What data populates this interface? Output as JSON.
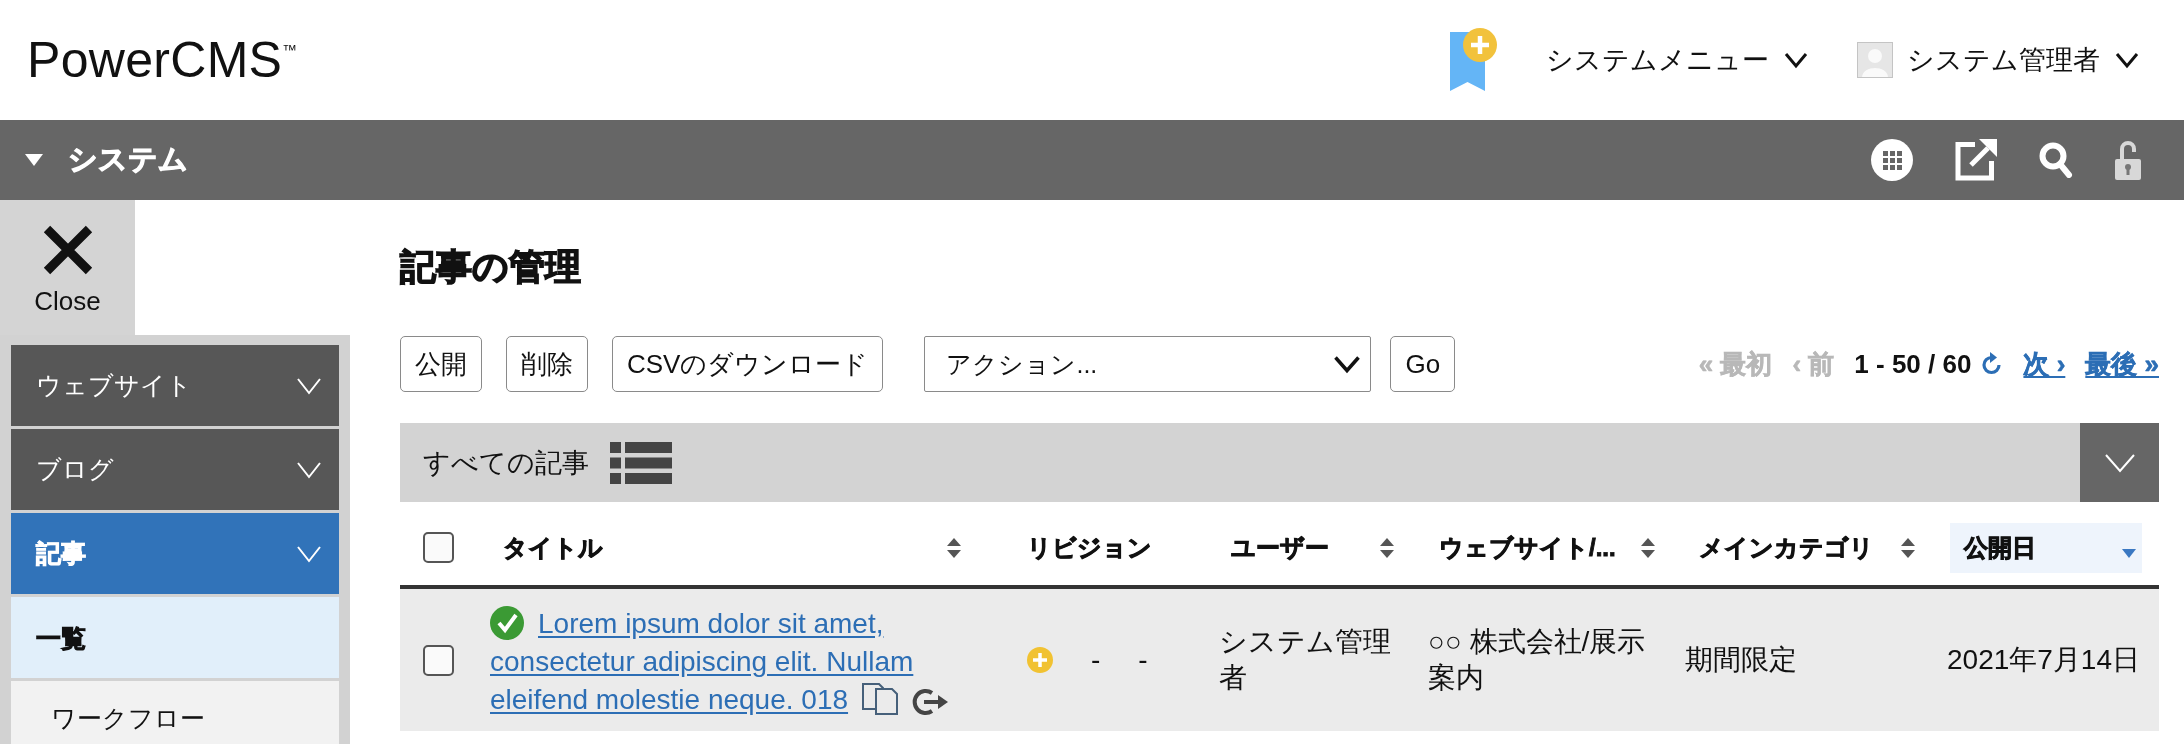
{
  "header": {
    "logo": "PowerCMS$^{™}$",
    "menus": [
      {
        "kind": "menu",
        "label": "システムメニュー"
      },
      {
        "kind": "user",
        "label": "システム管理者"
      }
    ]
  },
  "context_bar": {
    "title": "システム",
    "expanded": true
  },
  "sidebar": {
    "close_label": "Close",
    "items": [
      {
        "label": "ウェブサイト",
        "selected": false
      },
      {
        "label": "ブログ",
        "selected": false
      },
      {
        "label": "記事",
        "selected": true,
        "children": [
          {
            "label": "一覧",
            "selected": true
          },
          {
            "label": "ワークフロー",
            "selected": false
          }
        ]
      }
    ]
  },
  "page": {
    "title": "記事の管理"
  },
  "toolbar": {
    "buttons": [
      "公開",
      "削除",
      "CSVのダウンロード"
    ],
    "action_select": {
      "value": "アクション..."
    },
    "go_button": "Go"
  },
  "pagination": [
    {
      "kind": "link",
      "label": "« 最初",
      "disabled": true
    },
    {
      "kind": "link",
      "label": "‹ 前",
      "disabled": true
    },
    {
      "kind": "range",
      "label": "1 - 50 / 60"
    },
    {
      "kind": "link",
      "label": "次 ›",
      "disabled": false
    },
    {
      "kind": "link",
      "label": "最後 »",
      "disabled": false
    }
  ],
  "filter_bar": {
    "label": "すべての記事"
  },
  "table": {
    "select_all": {
      "checked": false
    },
    "columns": [
      {
        "label": "タイトル",
        "sortable": true,
        "sorted": false
      },
      {
        "label": "リビジョン",
        "sortable": false,
        "sorted": false
      },
      {
        "label": "ユーザー",
        "sortable": true,
        "sorted": false
      },
      {
        "label": "ウェブサイト/...",
        "sortable": true,
        "sorted": false
      },
      {
        "label": "メインカテゴリ",
        "sortable": true,
        "sorted": false
      },
      {
        "label": "公開日",
        "sortable": true,
        "sorted": true
      }
    ],
    "rows": [
      {
        "checked": false,
        "published": true,
        "title": "Lorem ipsum dolor sit amet, consectetur adipiscing elit. Nullam eleifend molestie neque. 018",
        "revision": [
          "-",
          "-"
        ],
        "user": "システム管理者",
        "website": "○○ 株式会社/展示案内",
        "category": "期間限定",
        "date": "2021年7月14日"
      }
    ]
  }
}
